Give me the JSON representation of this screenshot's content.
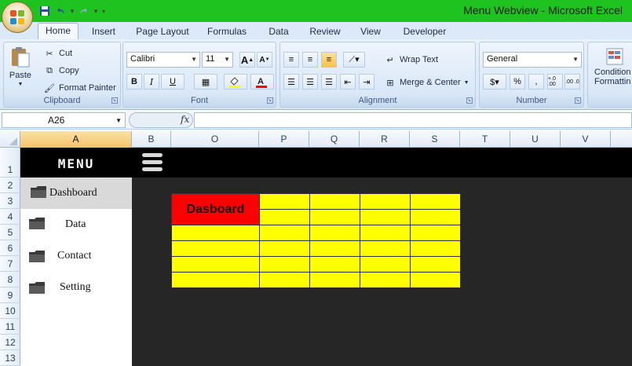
{
  "window": {
    "title": "Menu Webview - Microsoft Excel"
  },
  "quick_access": {
    "icons": [
      "save-icon",
      "undo-icon",
      "redo-icon",
      "customize-icon"
    ]
  },
  "ribbon": {
    "tabs": [
      "Home",
      "Insert",
      "Page Layout",
      "Formulas",
      "Data",
      "Review",
      "View",
      "Developer"
    ],
    "active_tab": "Home",
    "clipboard": {
      "label": "Clipboard",
      "paste": "Paste",
      "cut": "Cut",
      "copy": "Copy",
      "format_painter": "Format Painter"
    },
    "font": {
      "label": "Font",
      "family": "Calibri",
      "size": "11",
      "bold": "B",
      "italic": "I",
      "underline": "U"
    },
    "alignment": {
      "label": "Alignment",
      "wrap_text": "Wrap Text",
      "merge_center": "Merge & Center"
    },
    "number": {
      "label": "Number",
      "format": "General",
      "percent": "%",
      "comma": ",",
      "inc_decimal": "+.0 .00",
      "dec_decimal": ".00 .0"
    },
    "styles": {
      "conditional_line1": "Condition",
      "conditional_line2": "Formattin"
    }
  },
  "formula_bar": {
    "name_box": "A26",
    "fx": "fx",
    "formula": ""
  },
  "columns": [
    "A",
    "B",
    "O",
    "P",
    "Q",
    "R",
    "S",
    "T",
    "U",
    "V"
  ],
  "selected_column": "A",
  "rows": [
    "1",
    "2",
    "3",
    "4",
    "5",
    "6",
    "7",
    "8",
    "9",
    "10",
    "11",
    "12",
    "13"
  ],
  "sheet": {
    "menu_title": "MENU",
    "menu_items": [
      {
        "label": "Dashboard",
        "active": true
      },
      {
        "label": "Data",
        "active": false
      },
      {
        "label": "Contact",
        "active": false
      },
      {
        "label": "Setting",
        "active": false
      }
    ],
    "table_header": "Dasboard",
    "colors": {
      "header_bg": "#000000",
      "content_bg": "#262626",
      "table_fill": "#ffff00",
      "table_header_fill": "#ff0000",
      "active_item_bg": "#d9d9d9"
    }
  }
}
